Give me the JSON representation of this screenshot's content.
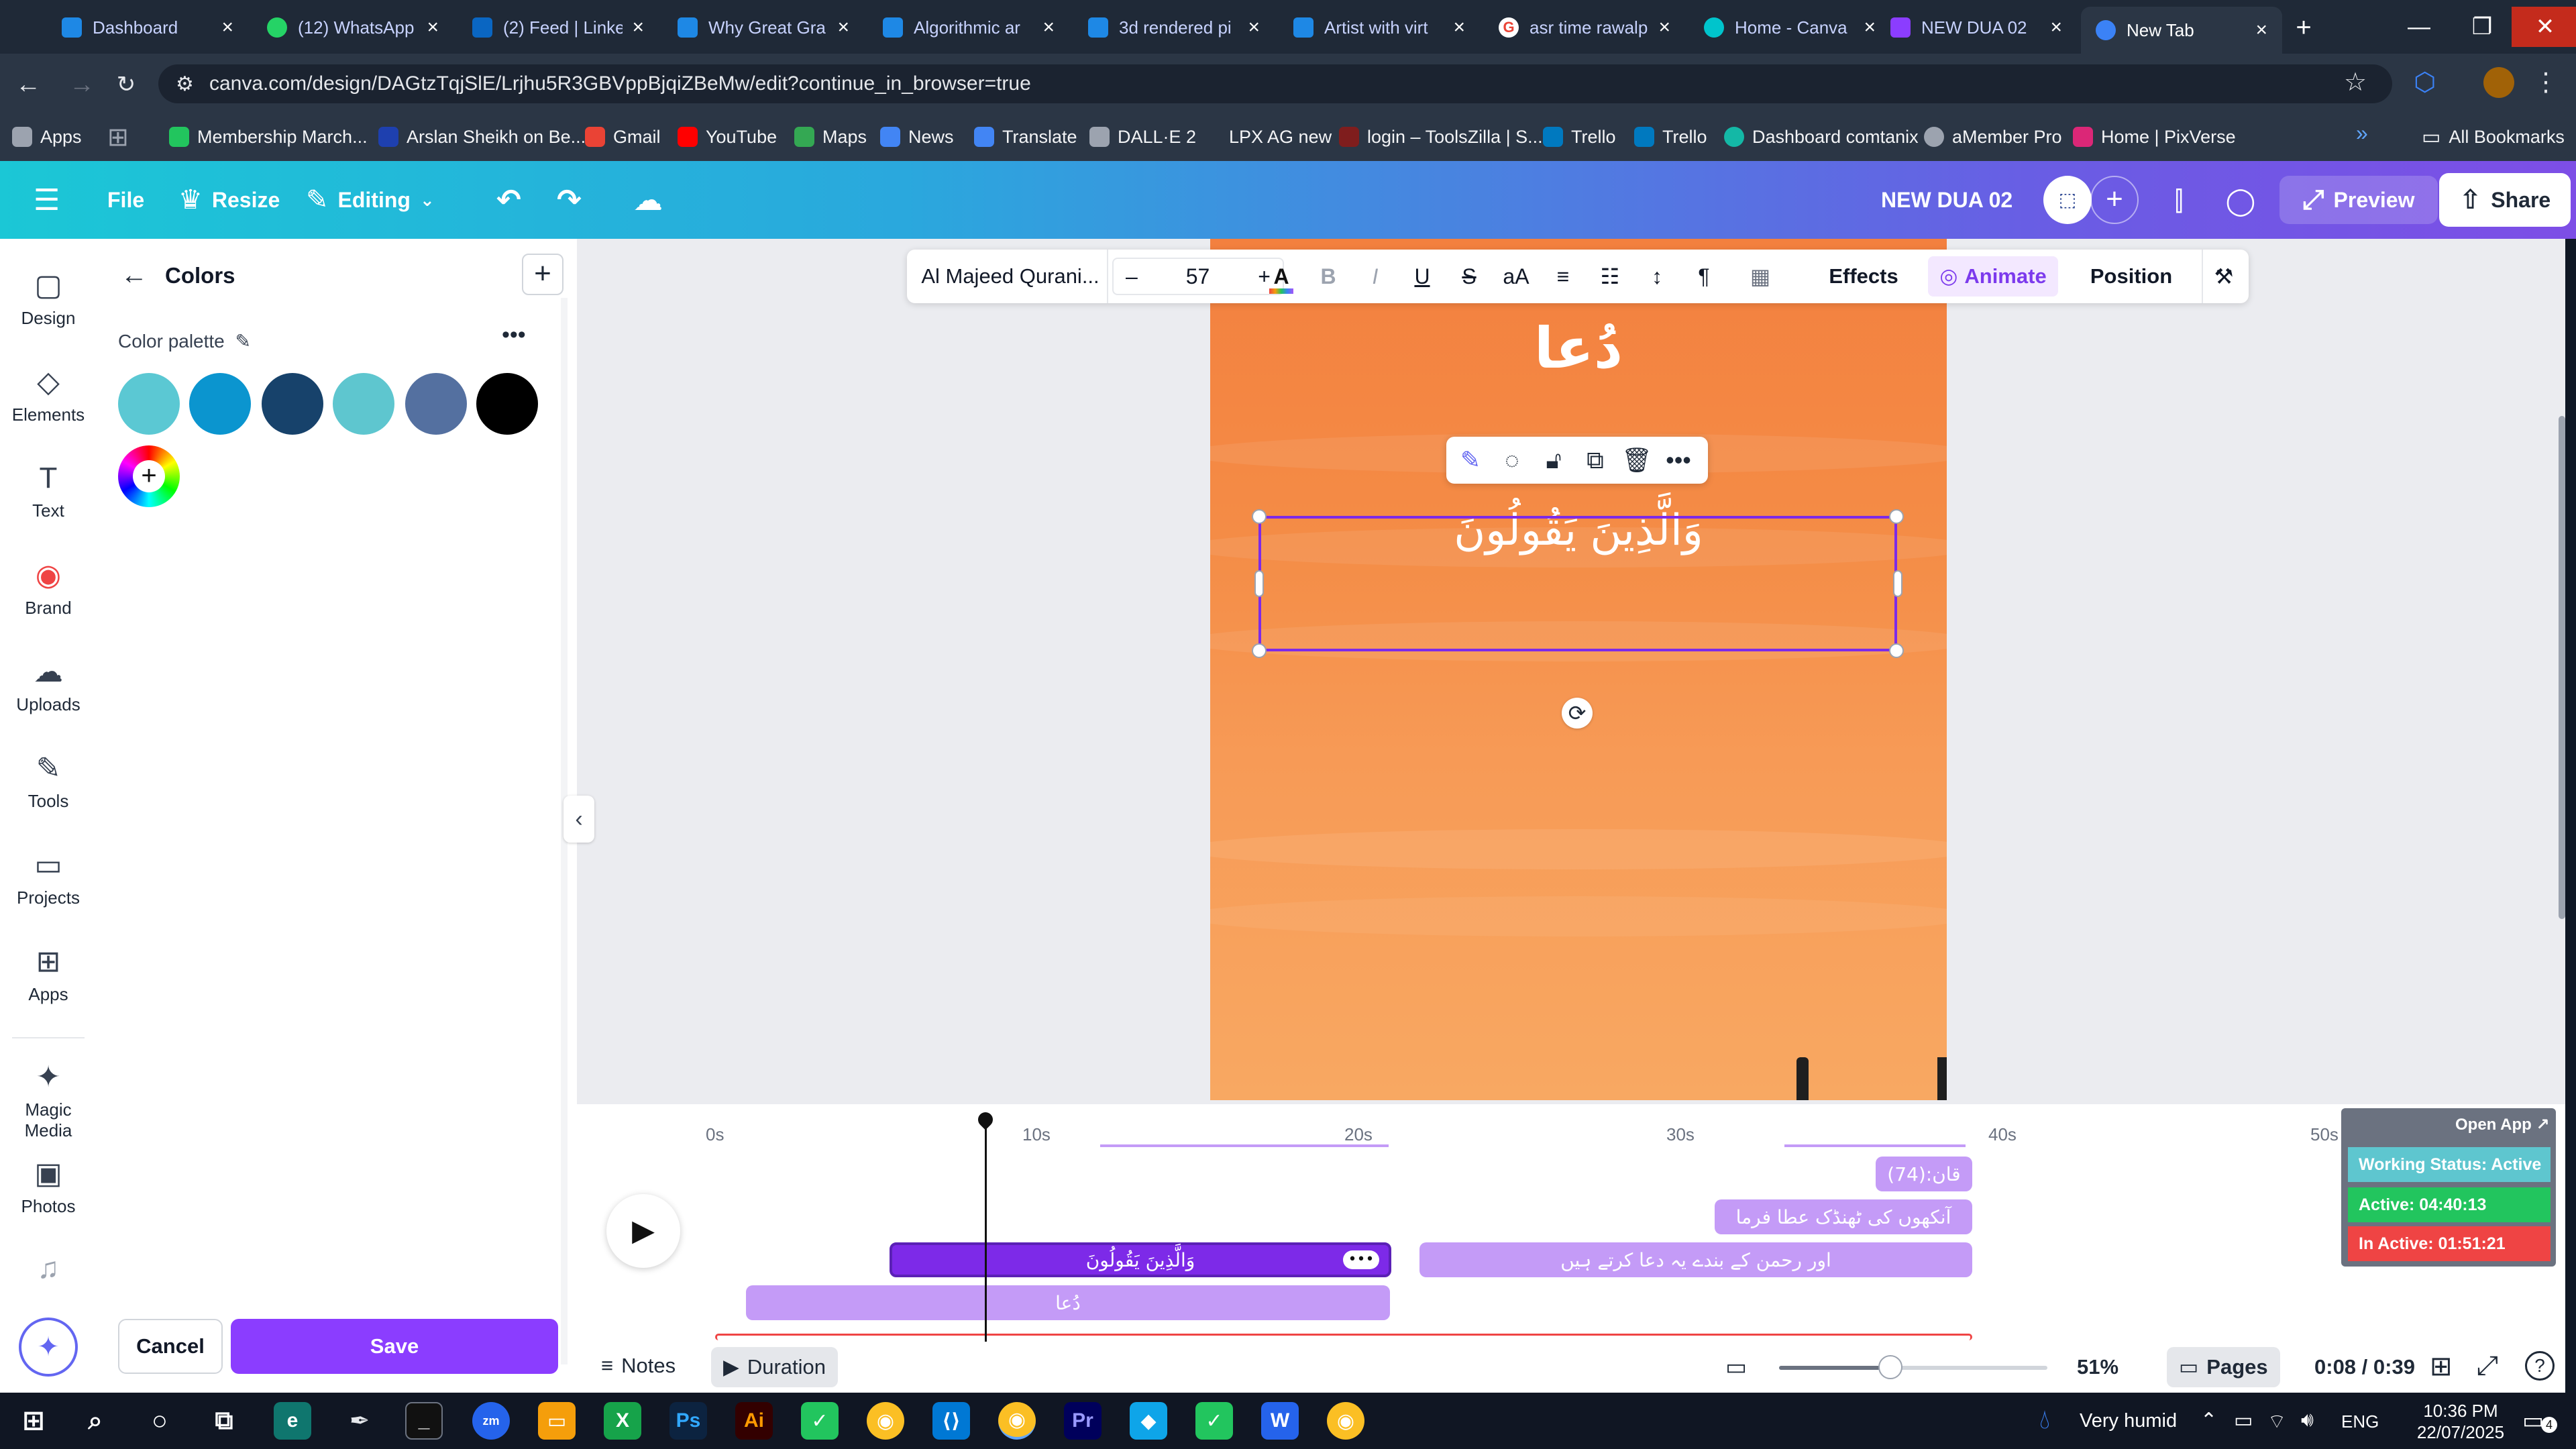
{
  "browser": {
    "tabs": [
      {
        "label": "Dashboard",
        "color": "#1e88e5"
      },
      {
        "label": "(12) WhatsApp",
        "color": "#25d366"
      },
      {
        "label": "(2) Feed | Linke",
        "color": "#0a66c2"
      },
      {
        "label": "Why Great Gra",
        "color": "#1e88e5"
      },
      {
        "label": "Algorithmic ar",
        "color": "#1e88e5"
      },
      {
        "label": "3d rendered pi",
        "color": "#1e88e5"
      },
      {
        "label": "Artist with virt",
        "color": "#1e88e5"
      },
      {
        "label": "asr time rawalp",
        "color": "#ea4335"
      },
      {
        "label": "Home - Canva",
        "color": "#00c4cc"
      },
      {
        "label": "NEW DUA 02",
        "color": "#8b3dff"
      },
      {
        "label": "New Tab",
        "color": "#3b82f6"
      }
    ],
    "url": "canva.com/design/DAGtzTqjSlE/Lrjhu5R3GBVppBjqiZBeMw/edit?continue_in_browser=true",
    "bookmarks": [
      {
        "label": "Apps",
        "color": "#9ca3af"
      },
      {
        "label": "Membership March...",
        "color": "#22c55e"
      },
      {
        "label": "Arslan Sheikh on Be...",
        "color": "#1e40af"
      },
      {
        "label": "Gmail",
        "color": "#ea4335"
      },
      {
        "label": "YouTube",
        "color": "#ff0000"
      },
      {
        "label": "Maps",
        "color": "#34a853"
      },
      {
        "label": "News",
        "color": "#4285f4"
      },
      {
        "label": "Translate",
        "color": "#4285f4"
      },
      {
        "label": "DALL·E 2",
        "color": "#9ca3af"
      },
      {
        "label": "LPX AG new",
        "color": "#9ca3af"
      },
      {
        "label": "login – ToolsZilla | S...",
        "color": "#7f1d1d"
      },
      {
        "label": "Trello",
        "color": "#0079bf"
      },
      {
        "label": "Trello",
        "color": "#0079bf"
      },
      {
        "label": "Dashboard comtanix",
        "color": "#14b8a6"
      },
      {
        "label": "aMember Pro",
        "color": "#9ca3af"
      },
      {
        "label": "Home | PixVerse",
        "color": "#db2777"
      }
    ],
    "all_bookmarks": "All Bookmarks"
  },
  "canva_header": {
    "file": "File",
    "resize": "Resize",
    "editing": "Editing",
    "doc_title": "NEW DUA 02",
    "preview": "Preview",
    "share": "Share"
  },
  "rail": [
    {
      "label": "Design",
      "icon": "design-icon",
      "glyph": "▢"
    },
    {
      "label": "Elements",
      "icon": "elements-icon",
      "glyph": "◇"
    },
    {
      "label": "Text",
      "icon": "text-icon",
      "glyph": "T"
    },
    {
      "label": "Brand",
      "icon": "brand-icon",
      "glyph": "◉"
    },
    {
      "label": "Uploads",
      "icon": "uploads-icon",
      "glyph": "☁"
    },
    {
      "label": "Tools",
      "icon": "tools-icon",
      "glyph": "✎"
    },
    {
      "label": "Projects",
      "icon": "projects-icon",
      "glyph": "▭"
    },
    {
      "label": "Apps",
      "icon": "apps-icon",
      "glyph": "⊞"
    },
    {
      "label": "Magic Media",
      "icon": "magic-media-icon",
      "glyph": "✦"
    },
    {
      "label": "Photos",
      "icon": "photos-icon",
      "glyph": "▣"
    }
  ],
  "panel": {
    "title": "Colors",
    "palette_label": "Color palette",
    "swatches": [
      "#5bc8d3",
      "#0b95cf",
      "#17426b",
      "#5ec6cf",
      "#5470a0",
      "#000000"
    ],
    "cancel": "Cancel",
    "save": "Save"
  },
  "text_toolbar": {
    "font": "Al Majeed Qurani...",
    "size": "57",
    "effects": "Effects",
    "animate": "Animate",
    "position": "Position"
  },
  "canvas": {
    "heading": "دُعا",
    "selected_text": "وَالَّذِينَ يَقُولُونَ"
  },
  "timeline": {
    "ticks": [
      "0s",
      "10s",
      "20s",
      "30s",
      "40s",
      "50s"
    ],
    "clips": [
      {
        "label": "قان:(74)"
      },
      {
        "label": "آنکھوں کی ٹھنڈک عطا فرما"
      },
      {
        "label": "وَالَّذِينَ يَقُولُونَ"
      },
      {
        "label": "اور رحمن کے بندے یہ دعا کرتے ہیں"
      },
      {
        "label": "دُعا"
      }
    ]
  },
  "bottom_bar": {
    "notes": "Notes",
    "duration": "Duration",
    "zoom": "51%",
    "pages": "Pages",
    "time": "0:08 / 0:39"
  },
  "widget": {
    "open_app": "Open App ↗",
    "status": "Working Status: Active",
    "active": "Active: 04:40:13",
    "inactive": "In Active: 01:51:21"
  },
  "taskbar": {
    "weather": "Very humid",
    "lang": "ENG",
    "time": "10:36 PM",
    "date": "22/07/2025",
    "notif_count": "4"
  }
}
